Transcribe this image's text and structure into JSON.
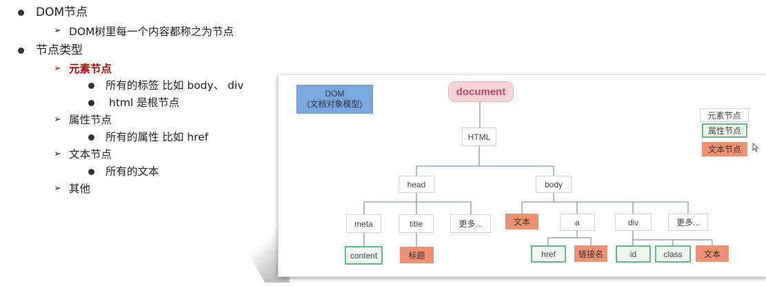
{
  "outline": {
    "item1": "DOM节点",
    "item1_sub": "DOM树里每一个内容都称之为节点",
    "item2": "节点类型",
    "element_node": "元素节点",
    "element_b1": "所有的标签 比如 body、 div",
    "element_b2": "html 是根节点",
    "attr_node": "属性节点",
    "attr_b1": "所有的属性 比如 href",
    "text_node": "文本节点",
    "text_b1": "所有的文本",
    "other": "其他"
  },
  "diagram": {
    "dom_label": "DOM",
    "dom_sub": "(文档对象模型)",
    "document": "document",
    "html": "HTML",
    "head": "head",
    "body": "body",
    "meta": "meta",
    "title": "title",
    "more1": "更多...",
    "text1": "文本",
    "a": "a",
    "div": "div",
    "more2": "更多...",
    "content": "content",
    "title_text": "标题",
    "href": "href",
    "link_name": "链接名",
    "id": "id",
    "class": "class",
    "text2": "文本",
    "legend": {
      "element": "元素节点",
      "attribute": "属性节点",
      "text": "文本节点"
    }
  },
  "colors": {
    "accent_red": "#c00000",
    "dom_blue": "#79a9dc",
    "attr_green": "#5cbf7f",
    "text_orange": "#ee9170",
    "document_pink": "#f6d3d3"
  }
}
